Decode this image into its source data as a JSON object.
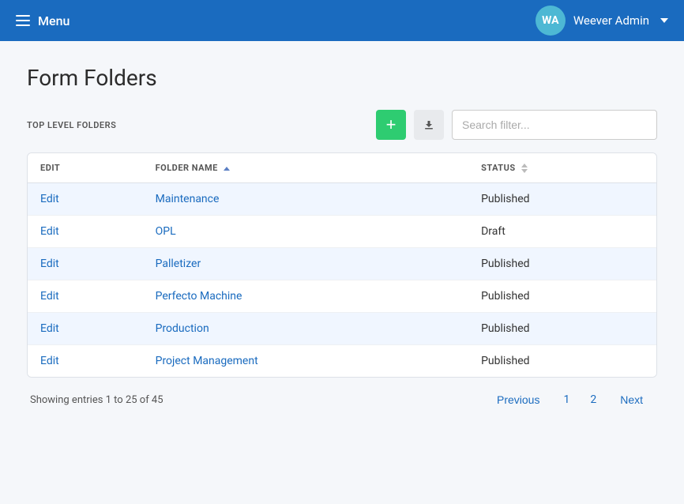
{
  "header": {
    "menu_label": "Menu",
    "avatar_initials": "WA",
    "admin_name": "Weever Admin",
    "chevron": "▾"
  },
  "page": {
    "title": "Form Folders"
  },
  "toolbar": {
    "top_level_label": "TOP LEVEL FOLDERS",
    "add_label": "+",
    "download_label": "↓",
    "search_placeholder": "Search filter..."
  },
  "table": {
    "columns": [
      {
        "key": "edit",
        "label": "EDIT",
        "sortable": false
      },
      {
        "key": "folder_name",
        "label": "FOLDER NAME",
        "sortable": true
      },
      {
        "key": "status",
        "label": "STATUS",
        "sortable": true
      }
    ],
    "rows": [
      {
        "edit": "Edit",
        "folder_name": "Maintenance",
        "status": "Published"
      },
      {
        "edit": "Edit",
        "folder_name": "OPL",
        "status": "Draft"
      },
      {
        "edit": "Edit",
        "folder_name": "Palletizer",
        "status": "Published"
      },
      {
        "edit": "Edit",
        "folder_name": "Perfecto Machine",
        "status": "Published"
      },
      {
        "edit": "Edit",
        "folder_name": "Production",
        "status": "Published"
      },
      {
        "edit": "Edit",
        "folder_name": "Project Management",
        "status": "Published"
      }
    ]
  },
  "footer": {
    "showing_text": "Showing entries 1 to 25 of 45",
    "previous_label": "Previous",
    "next_label": "Next",
    "pages": [
      "1",
      "2"
    ]
  }
}
